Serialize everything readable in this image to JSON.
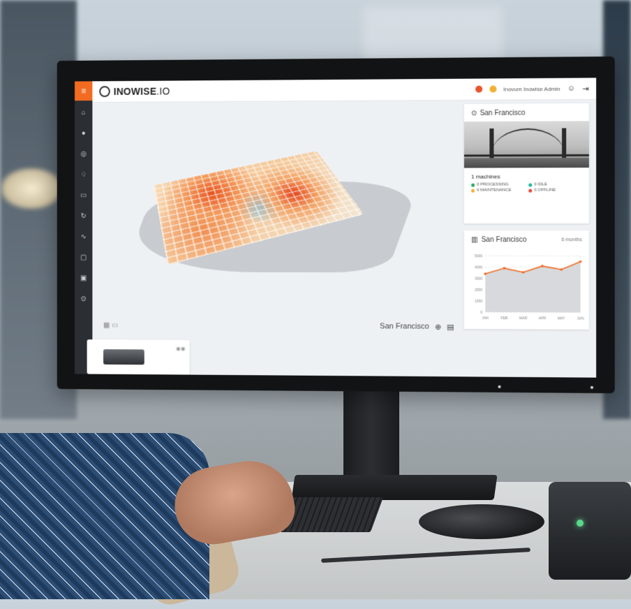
{
  "app": {
    "logo_text_bold": "INOWISE",
    "logo_text_light": ".IO",
    "user_name": "Inovum Inowise Admin"
  },
  "sidebar": {
    "items": [
      "home-icon",
      "globe-icon",
      "target-icon",
      "bell-icon",
      "server-icon",
      "refresh-icon",
      "activity-icon",
      "lock-icon",
      "briefcase-icon",
      "location-icon"
    ]
  },
  "map": {
    "city": "San Francisco"
  },
  "location_card": {
    "title": "San Francisco",
    "machines": "1 machines",
    "statuses": [
      {
        "label": "0 PROCESSING",
        "color": "#27ae60"
      },
      {
        "label": "0 IDLE",
        "color": "#1abc9c"
      },
      {
        "label": "0 MAINTENANCE",
        "color": "#f1b233"
      },
      {
        "label": "0 OFFLINE",
        "color": "#e74c3c"
      }
    ]
  },
  "chart_card": {
    "title": "San Francisco",
    "range": "6 months"
  },
  "chart_data": {
    "type": "area",
    "categories": [
      "JAN",
      "FEB",
      "MAR",
      "APR",
      "MAY",
      "JUN"
    ],
    "series": [
      {
        "values": [
          3400,
          3900,
          3550,
          4100,
          3800,
          4500
        ]
      }
    ],
    "ylim": [
      0,
      5000
    ],
    "yticks": [
      0,
      1000,
      2000,
      3000,
      4000,
      5000
    ],
    "grid": true,
    "line_color": "#f26b21"
  }
}
